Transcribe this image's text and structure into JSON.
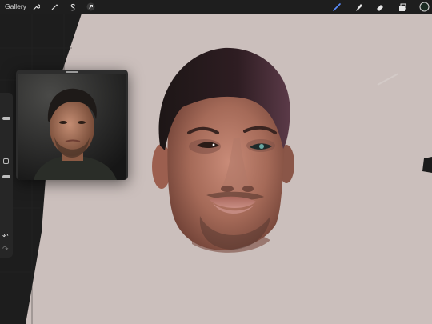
{
  "toolbar": {
    "gallery_label": "Gallery",
    "left_tools": [
      {
        "name": "actions-wrench-icon"
      },
      {
        "name": "adjustments-wand-icon"
      },
      {
        "name": "selection-s-icon"
      },
      {
        "name": "transform-arrow-icon"
      }
    ],
    "right_tools": [
      {
        "name": "brush-icon"
      },
      {
        "name": "smudge-icon"
      },
      {
        "name": "eraser-icon"
      },
      {
        "name": "layers-icon"
      },
      {
        "name": "color-swatch-icon"
      }
    ],
    "active_tool": "brush-icon",
    "accent_color": "#5b8dff",
    "current_color": "#1b2b22"
  },
  "canvas": {
    "background_color": "#cbbfbc",
    "backdrop_color": "#1d1d1d"
  },
  "sidebar": {
    "brush_size": 0.35,
    "opacity": 0.8,
    "undo_icon": "undo-arrow-icon",
    "redo_icon": "redo-arrow-icon"
  },
  "reference_window": {
    "content": "reference-photo-of-man"
  }
}
